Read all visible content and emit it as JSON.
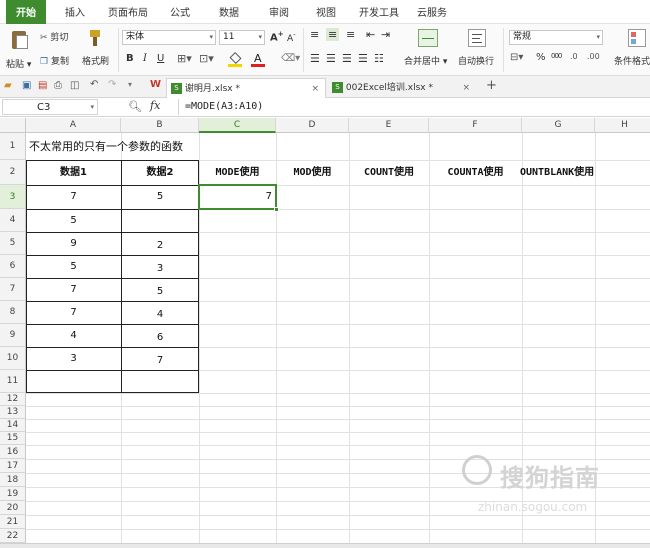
{
  "menu": {
    "tabs": [
      "开始",
      "插入",
      "页面布局",
      "公式",
      "数据",
      "审阅",
      "视图",
      "开发工具",
      "云服务"
    ]
  },
  "ribbon": {
    "paste": "粘贴",
    "cut": "剪切",
    "copy": "复制",
    "format_painter": "格式刷",
    "font_name": "宋体",
    "font_size": "11",
    "merge_center": "合并居中",
    "wrap_text": "自动换行",
    "number_format": "常规",
    "conditional_format": "条件格式",
    "percent": "%",
    "comma": "000"
  },
  "doc_tabs": [
    "谢明月.xlsx *",
    "002Excel培训.xlsx *"
  ],
  "formula_bar": {
    "name_box": "C3",
    "fx": "fx",
    "formula": "=MODE(A3:A10)"
  },
  "sheet": {
    "columns": [
      "A",
      "B",
      "C",
      "D",
      "E",
      "F",
      "G",
      "H"
    ],
    "rows": [
      "1",
      "2",
      "3",
      "4",
      "5",
      "6",
      "7",
      "8",
      "9",
      "10",
      "11",
      "12",
      "13",
      "14",
      "15",
      "16",
      "17",
      "18",
      "19",
      "20",
      "21",
      "22"
    ],
    "title": "不太常用的只有一个参数的函数",
    "headers": [
      "数据1",
      "数据2",
      "MODE使用",
      "MOD使用",
      "COUNT使用",
      "COUNTA使用",
      "OUNTBLANK使用"
    ],
    "data1": [
      "7",
      "5",
      "9",
      "5",
      "7",
      "7",
      "4",
      "3"
    ],
    "data2": [
      "5",
      "",
      "2",
      "3",
      "5",
      "4",
      "6",
      "7"
    ],
    "mode_result": "7"
  },
  "watermark": {
    "brand": "搜狗指南",
    "url": "zhinan.sogou.com"
  },
  "colors": {
    "accent": "#3e8c2e",
    "active_tab_text": "#ffffff"
  }
}
